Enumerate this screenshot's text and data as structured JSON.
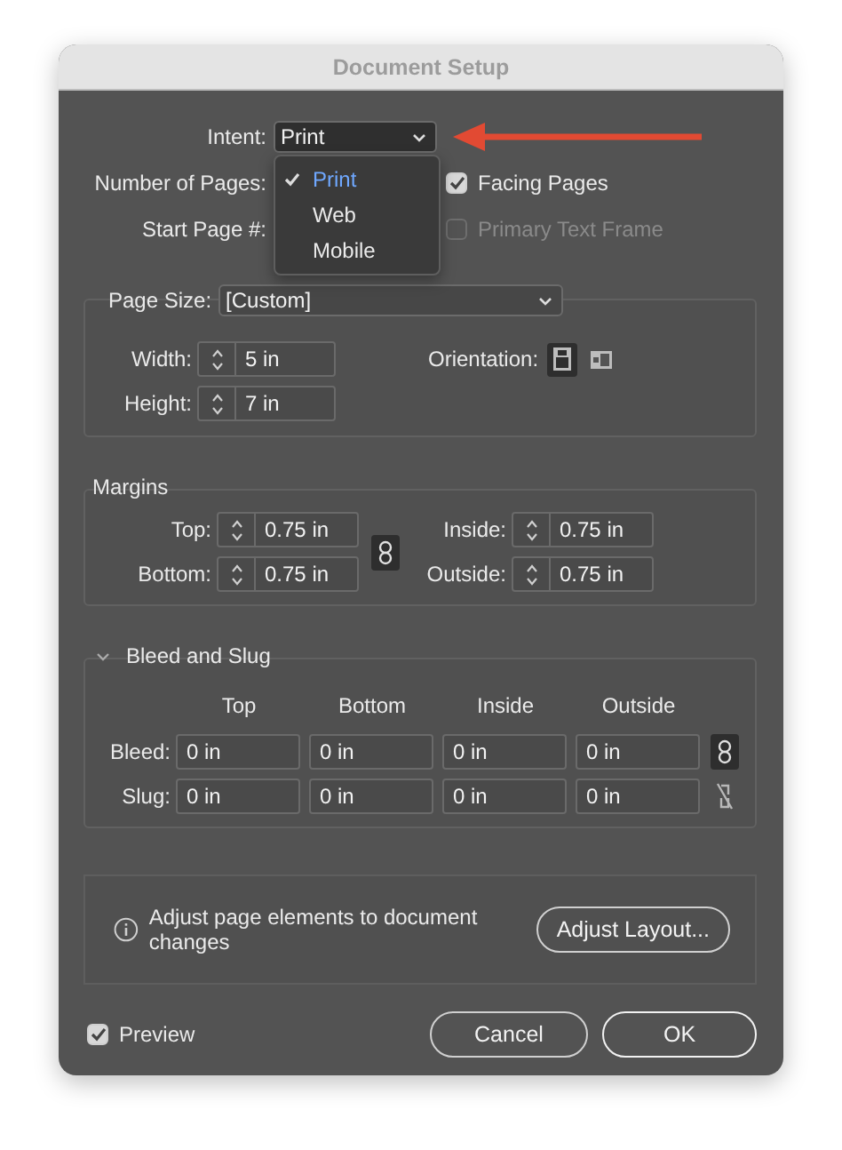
{
  "window": {
    "title": "Document Setup"
  },
  "intent": {
    "label": "Intent:",
    "value": "Print",
    "menu": [
      {
        "label": "Print",
        "selected": true
      },
      {
        "label": "Web",
        "selected": false
      },
      {
        "label": "Mobile",
        "selected": false
      }
    ]
  },
  "number_of_pages": {
    "label": "Number of Pages:"
  },
  "start_page": {
    "label": "Start Page #:"
  },
  "checkboxes": [
    {
      "label": "Facing Pages",
      "checked": true,
      "disabled": false
    },
    {
      "label": "Primary Text Frame",
      "checked": false,
      "disabled": true
    }
  ],
  "page_size": {
    "label": "Page Size:",
    "value": "[Custom]",
    "width": {
      "label": "Width:",
      "value": "5 in"
    },
    "height": {
      "label": "Height:",
      "value": "7 in"
    },
    "orientation": {
      "label": "Orientation:",
      "options": [
        {
          "kind": "portrait",
          "selected": true
        },
        {
          "kind": "landscape",
          "selected": false
        }
      ]
    }
  },
  "margins": {
    "title": "Margins",
    "linked": true,
    "fields": [
      {
        "label": "Top:",
        "value": "0.75 in"
      },
      {
        "label": "Inside:",
        "value": "0.75 in"
      },
      {
        "label": "Bottom:",
        "value": "0.75 in"
      },
      {
        "label": "Outside:",
        "value": "0.75 in"
      }
    ]
  },
  "bleed_slug": {
    "title": "Bleed and Slug",
    "expanded": true,
    "columns": [
      "Top",
      "Bottom",
      "Inside",
      "Outside"
    ],
    "rows": [
      {
        "label": "Bleed:",
        "values": [
          "0 in",
          "0 in",
          "0 in",
          "0 in"
        ],
        "linked": true
      },
      {
        "label": "Slug:",
        "values": [
          "0 in",
          "0 in",
          "0 in",
          "0 in"
        ],
        "linked": false
      }
    ]
  },
  "adjust": {
    "text": "Adjust page elements to document changes",
    "button": "Adjust Layout..."
  },
  "preview": {
    "label": "Preview",
    "checked": true
  },
  "buttons": [
    "Cancel",
    "OK"
  ]
}
